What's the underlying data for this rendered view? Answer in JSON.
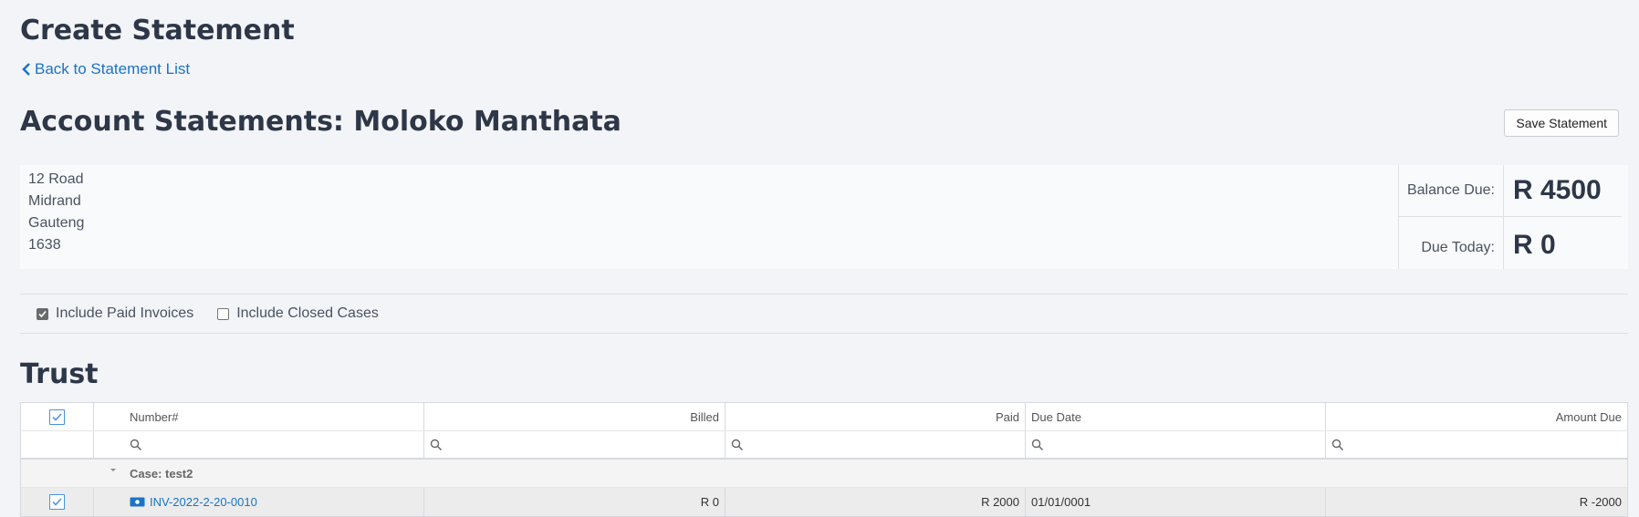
{
  "page": {
    "title": "Create Statement",
    "back_link": "Back to Statement List"
  },
  "account": {
    "title": "Account Statements: Moloko Manthata",
    "save_label": "Save Statement",
    "address": [
      "12 Road",
      "Midrand",
      "Gauteng",
      "1638"
    ],
    "balance_due_label": "Balance Due:",
    "balance_due_value": "R 4500",
    "due_today_label": "Due Today:",
    "due_today_value": "R 0"
  },
  "options": {
    "include_paid": {
      "label": "Include Paid Invoices",
      "checked": true
    },
    "include_closed": {
      "label": "Include Closed Cases",
      "checked": false
    }
  },
  "trust": {
    "title": "Trust",
    "columns": [
      "Number#",
      "Billed",
      "Paid",
      "Due Date",
      "Amount Due"
    ],
    "group_label": "Case: test2",
    "rows": [
      {
        "number": "INV-2022-2-20-0010",
        "billed": "R 0",
        "paid": "R 2000",
        "due_date": "01/01/0001",
        "amount_due": "R -2000"
      }
    ]
  },
  "colors": {
    "link": "#1a73c8",
    "checkbox_accent": "#4a90e2",
    "heading": "#2d3748"
  }
}
